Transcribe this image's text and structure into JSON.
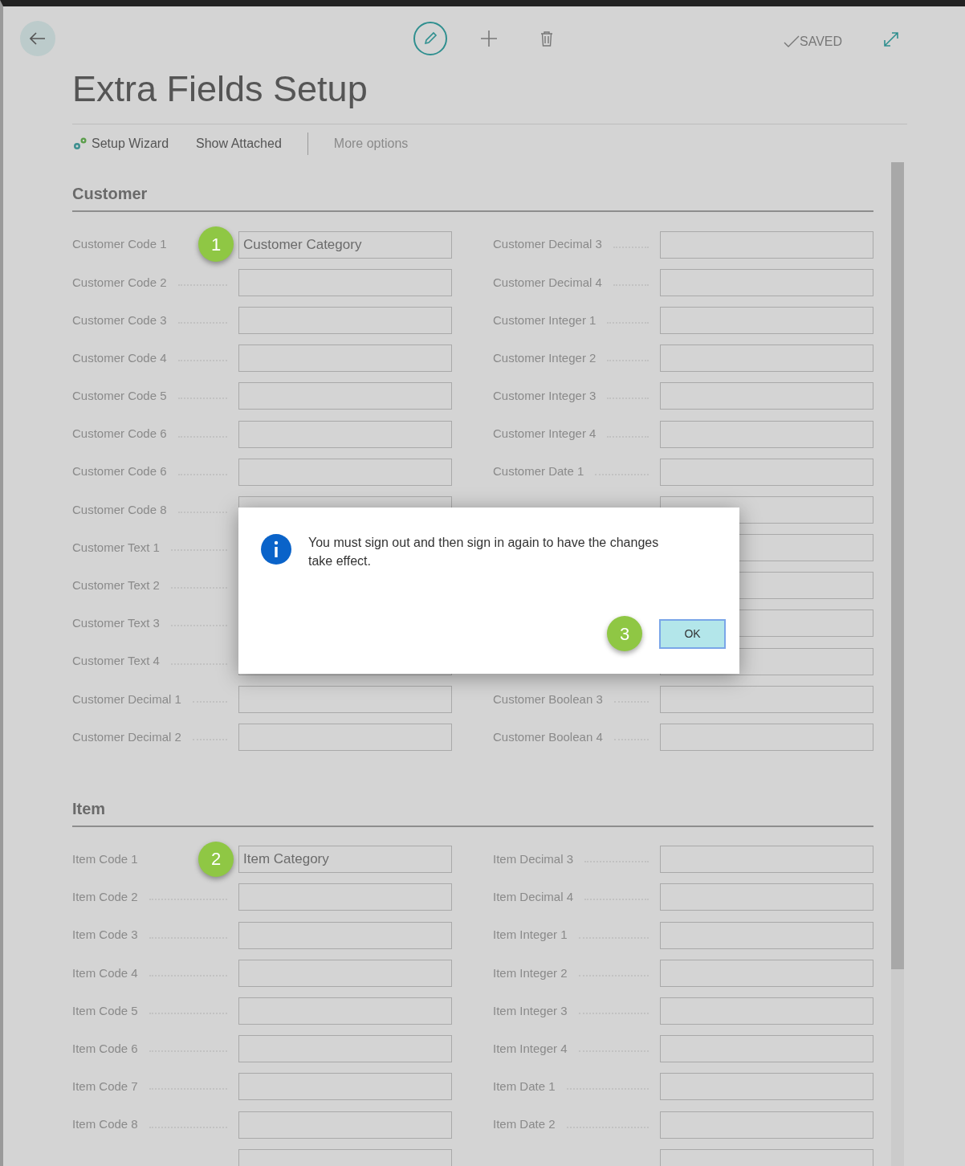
{
  "page": {
    "title": "Extra Fields Setup",
    "status": "SAVED"
  },
  "actions": [
    {
      "label": "Setup Wizard",
      "kind": "wizard"
    },
    {
      "label": "Show Attached",
      "kind": "plain"
    },
    {
      "label": "More options",
      "kind": "more"
    }
  ],
  "sections": [
    {
      "title": "Customer",
      "left": [
        {
          "kind": "labeled",
          "label": "Customer Code 1",
          "value": "Customer Category",
          "callout": "1"
        },
        {
          "kind": "labeled",
          "label": "Customer Code 2"
        },
        {
          "kind": "labeled",
          "label": "Customer Code 3"
        },
        {
          "kind": "labeled",
          "label": "Customer Code 4"
        },
        {
          "kind": "labeled",
          "label": "Customer Code 5"
        },
        {
          "kind": "labeled",
          "label": "Customer Code 6"
        },
        {
          "kind": "labeled",
          "label": "Customer Code 6"
        },
        {
          "kind": "labeled",
          "label": "Customer Code 8"
        },
        {
          "kind": "label_only",
          "label": "Customer Text 1"
        },
        {
          "kind": "label_only",
          "label": "Customer Text 2"
        },
        {
          "kind": "label_only",
          "label": "Customer Text 3"
        },
        {
          "kind": "labeled",
          "label": "Customer Text 4"
        },
        {
          "kind": "labeled",
          "label": "Customer Decimal 1"
        },
        {
          "kind": "labeled",
          "label": "Customer Decimal 2"
        }
      ],
      "right": [
        {
          "kind": "labeled",
          "label": "Customer Decimal 3"
        },
        {
          "kind": "labeled",
          "label": "Customer Decimal 4"
        },
        {
          "kind": "labeled",
          "label": "Customer Integer 1"
        },
        {
          "kind": "labeled",
          "label": "Customer Integer 2"
        },
        {
          "kind": "labeled",
          "label": "Customer Integer 3"
        },
        {
          "kind": "labeled",
          "label": "Customer Integer 4"
        },
        {
          "kind": "labeled",
          "label": "Customer Date 1"
        },
        {
          "kind": "covered"
        },
        {
          "kind": "covered"
        },
        {
          "kind": "covered"
        },
        {
          "kind": "covered"
        },
        {
          "kind": "covered"
        },
        {
          "kind": "labeled",
          "label": "Customer Boolean 3"
        },
        {
          "kind": "labeled",
          "label": "Customer Boolean 4"
        }
      ]
    },
    {
      "title": "Item",
      "left": [
        {
          "kind": "labeled",
          "label": "Item Code 1",
          "value": "Item Category",
          "callout": "2"
        },
        {
          "kind": "labeled",
          "label": "Item Code 2"
        },
        {
          "kind": "labeled",
          "label": "Item Code 3"
        },
        {
          "kind": "labeled",
          "label": "Item Code 4"
        },
        {
          "kind": "labeled",
          "label": "Item Code 5"
        },
        {
          "kind": "labeled",
          "label": "Item Code 6"
        },
        {
          "kind": "labeled",
          "label": "Item Code 7"
        },
        {
          "kind": "labeled",
          "label": "Item Code 8"
        },
        {
          "kind": "covered"
        }
      ],
      "right": [
        {
          "kind": "labeled",
          "label": "Item Decimal 3"
        },
        {
          "kind": "labeled",
          "label": "Item Decimal 4"
        },
        {
          "kind": "labeled",
          "label": "Item Integer 1"
        },
        {
          "kind": "labeled",
          "label": "Item Integer 2"
        },
        {
          "kind": "labeled",
          "label": "Item Integer 3"
        },
        {
          "kind": "labeled",
          "label": "Item Integer 4"
        },
        {
          "kind": "labeled",
          "label": "Item Date 1"
        },
        {
          "kind": "labeled",
          "label": "Item Date 2"
        },
        {
          "kind": "covered"
        }
      ]
    }
  ],
  "dialog": {
    "message": "You must sign out and then sign in again to have the changes take effect.",
    "button": "OK",
    "callout": "3"
  }
}
